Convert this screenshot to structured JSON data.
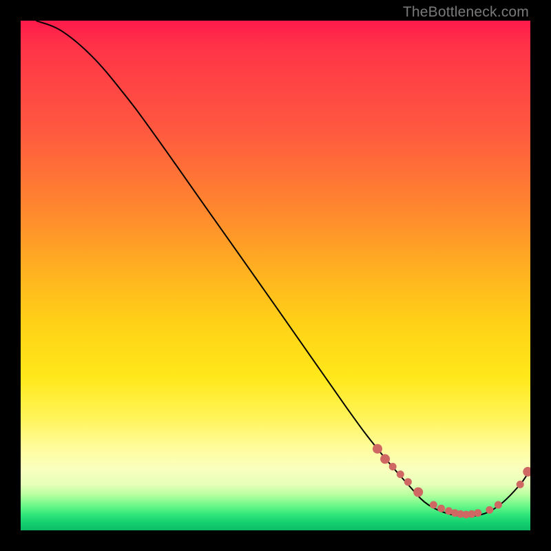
{
  "watermark": "TheBottleneck.com",
  "chart_data": {
    "type": "line",
    "title": "",
    "xlabel": "",
    "ylabel": "",
    "xlim": [
      0,
      100
    ],
    "ylim": [
      0,
      100
    ],
    "curve": [
      {
        "x": 3,
        "y": 100
      },
      {
        "x": 8,
        "y": 98
      },
      {
        "x": 14,
        "y": 93
      },
      {
        "x": 20,
        "y": 86
      },
      {
        "x": 26,
        "y": 78
      },
      {
        "x": 38,
        "y": 61
      },
      {
        "x": 50,
        "y": 44
      },
      {
        "x": 64,
        "y": 24
      },
      {
        "x": 70,
        "y": 16
      },
      {
        "x": 76,
        "y": 9
      },
      {
        "x": 80,
        "y": 5
      },
      {
        "x": 85,
        "y": 3
      },
      {
        "x": 90,
        "y": 3
      },
      {
        "x": 94,
        "y": 5
      },
      {
        "x": 98,
        "y": 9
      },
      {
        "x": 100,
        "y": 12
      }
    ],
    "series": [
      {
        "name": "highlighted-points",
        "points": [
          {
            "x": 70,
            "y": 16,
            "size": "md"
          },
          {
            "x": 71.5,
            "y": 14,
            "size": "md"
          },
          {
            "x": 73,
            "y": 12.5,
            "size": "sm"
          },
          {
            "x": 74.5,
            "y": 11,
            "size": "sm"
          },
          {
            "x": 76,
            "y": 9.5,
            "size": "sm"
          },
          {
            "x": 78,
            "y": 7.5,
            "size": "md"
          },
          {
            "x": 81,
            "y": 5,
            "size": "sm"
          },
          {
            "x": 82.5,
            "y": 4.3,
            "size": "sm"
          },
          {
            "x": 84,
            "y": 3.8,
            "size": "sm"
          },
          {
            "x": 85.2,
            "y": 3.4,
            "size": "sm"
          },
          {
            "x": 86.3,
            "y": 3.2,
            "size": "sm"
          },
          {
            "x": 87.4,
            "y": 3.1,
            "size": "sm"
          },
          {
            "x": 88.5,
            "y": 3.2,
            "size": "sm"
          },
          {
            "x": 89.7,
            "y": 3.4,
            "size": "sm"
          },
          {
            "x": 92,
            "y": 4.0,
            "size": "sm"
          },
          {
            "x": 93.7,
            "y": 5.0,
            "size": "sm"
          },
          {
            "x": 98,
            "y": 9,
            "size": "sm"
          },
          {
            "x": 99.5,
            "y": 11.5,
            "size": "md"
          }
        ]
      }
    ],
    "colors": {
      "curve": "#000000",
      "points": "#cf6863",
      "gradient_top": "#ff1a4b",
      "gradient_mid": "#ffe81a",
      "gradient_bottom": "#0bbd66"
    }
  }
}
